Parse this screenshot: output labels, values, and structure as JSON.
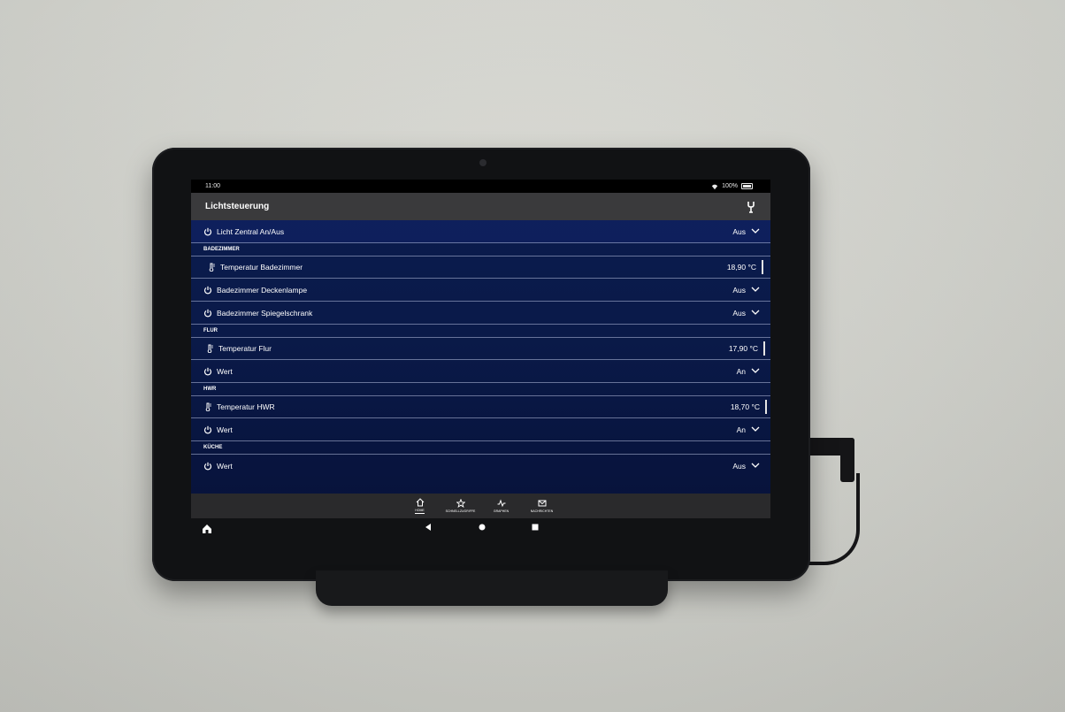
{
  "statusbar": {
    "time": "11:00",
    "battery": "100%"
  },
  "appbar": {
    "title": "Lichtsteuerung"
  },
  "rows": {
    "central": {
      "label": "Licht Zentral An/Aus",
      "value": "Aus"
    },
    "sec_bad": "BADEZIMMER",
    "bad_temp": {
      "label": "Temperatur Badezimmer",
      "value": "18,90 °C"
    },
    "bad_decke": {
      "label": "Badezimmer Deckenlampe",
      "value": "Aus"
    },
    "bad_spiegel": {
      "label": "Badezimmer Spiegelschrank",
      "value": "Aus"
    },
    "sec_flur": "FLUR",
    "flur_temp": {
      "label": "Temperatur Flur",
      "value": "17,90 °C"
    },
    "flur_wert": {
      "label": "Wert",
      "value": "An"
    },
    "sec_hwr": "HWR",
    "hwr_temp": {
      "label": "Temperatur  HWR",
      "value": "18,70 °C"
    },
    "hwr_wert": {
      "label": "Wert",
      "value": "An"
    },
    "sec_kueche": "KÜCHE",
    "kueche_wert": {
      "label": "Wert",
      "value": "Aus"
    }
  },
  "nav": {
    "home": "HOME",
    "schnell": "SCHNELLZUGRIFFE",
    "graphen": "GRAPHEN",
    "nachrichten": "NACHRICHTEN"
  },
  "icons": {
    "power": "power-icon",
    "thermo": "thermometer-icon",
    "chevron": "chevron-down-icon",
    "wrench": "wrench-icon"
  }
}
